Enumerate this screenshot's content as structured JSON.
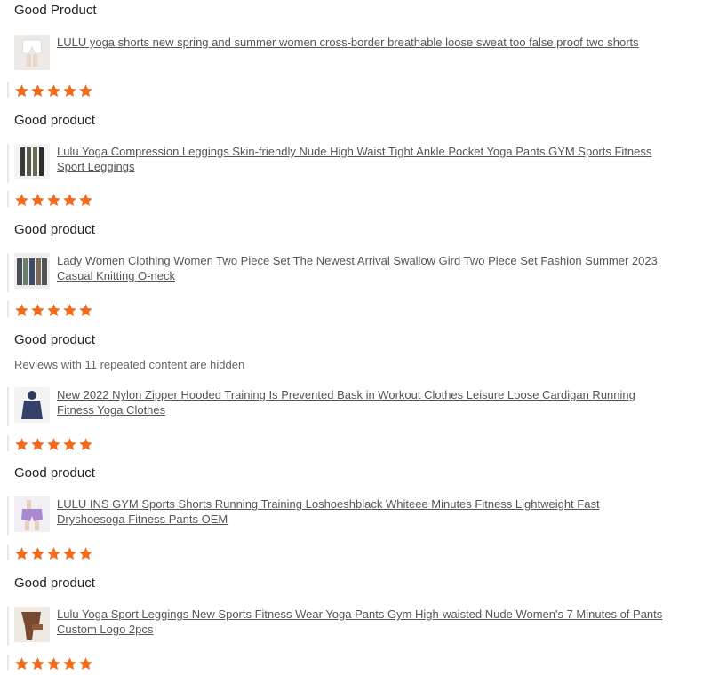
{
  "reviews": [
    {
      "text": "Good Product",
      "product": {
        "title": "LULU yoga shorts new spring and summer women cross-border breathable loose sweat too false proof two shorts",
        "thumb_icon": "white-shorts-thumbnail"
      },
      "rating": 5
    },
    {
      "text": "Good product",
      "product": {
        "title": "Lulu Yoga Compression Leggings Skin-friendly Nude High Waist Tight Ankle Pocket Yoga Pants GYM Sports Fitness Sport Leggings",
        "thumb_icon": "leggings-thumbnail"
      },
      "rating": 5
    },
    {
      "text": "Good product",
      "product": {
        "title": "Lady Women Clothing Women Two Piece Set The Newest Arrival Swallow Gird Two Piece Set Fashion Summer 2023 Casual Knitting O-neck",
        "thumb_icon": "two-piece-set-thumbnail"
      },
      "rating": 5
    },
    {
      "text": "Good product",
      "hidden_note": "Reviews with 11 repeated content are hidden",
      "product": {
        "title": "New 2022 Nylon Zipper Hooded Training Is Prevented Bask in Workout Clothes Leisure Loose Cardigan Running Fitness Yoga Clothes",
        "thumb_icon": "hooded-jacket-thumbnail"
      },
      "rating": 5
    },
    {
      "text": "Good product",
      "product": {
        "title": "LULU INS GYM Sports Shorts Running Training Loshoeshblack Whiteee Minutes Fitness Lightweight Fast Dryshoesoga Fitness Pants OEM",
        "thumb_icon": "purple-shorts-thumbnail"
      },
      "rating": 5
    },
    {
      "text": "Good product",
      "product": {
        "title": "Lulu Yoga Sport Leggings New Sports Fitness Wear Yoga Pants Gym High-waisted Nude Women's 7 Minutes of Pants Custom Logo 2pcs",
        "thumb_icon": "brown-leggings-thumbnail"
      },
      "rating": 5
    }
  ],
  "colors": {
    "star": "#f26a1b",
    "link": "#555555"
  }
}
